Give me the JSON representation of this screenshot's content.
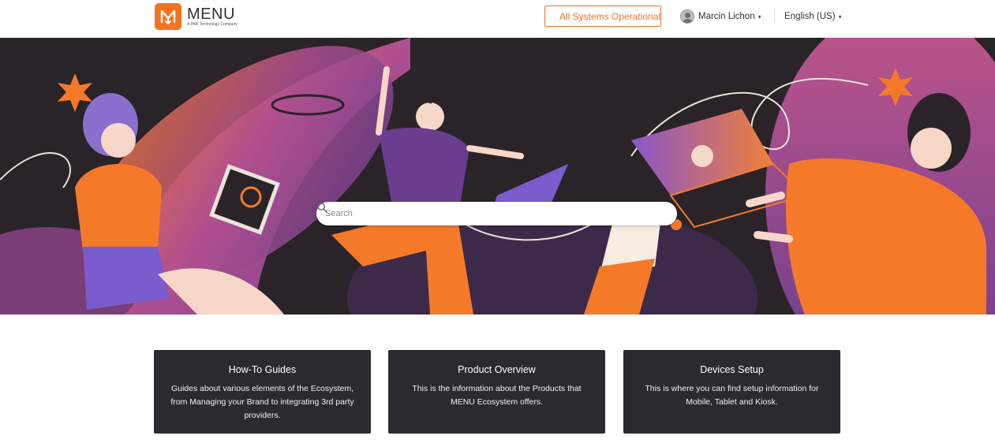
{
  "header": {
    "logo": {
      "word": "MENU",
      "tagline": "A PAR Technology Company"
    },
    "status": {
      "label": "All Systems Operational",
      "dot_color": "#2fb36f"
    },
    "user": {
      "name": "Marcin Lichon",
      "avatar_icon": "user-avatar-icon"
    },
    "language": {
      "label": "English (US)"
    },
    "chevron_icon": "chevron-down-icon"
  },
  "hero": {
    "search": {
      "placeholder": "Search",
      "value": "",
      "icon": "search-icon"
    },
    "illustration": "people-with-devices-illustration"
  },
  "cards": [
    {
      "title": "How-To Guides",
      "description": "Guides about various elements of the Ecosystem, from Managing your Brand to integrating 3rd party providers."
    },
    {
      "title": "Product Overview",
      "description": "This is the information about the Products that MENU Ecosystem offers."
    },
    {
      "title": "Devices Setup",
      "description": "This is where you can find setup information for Mobile, Tablet and Kiosk."
    }
  ],
  "colors": {
    "brand": "#f37321",
    "hero_bg": "#2a2428",
    "card_bg": "#2b2a2e",
    "status_green": "#2fb36f"
  }
}
